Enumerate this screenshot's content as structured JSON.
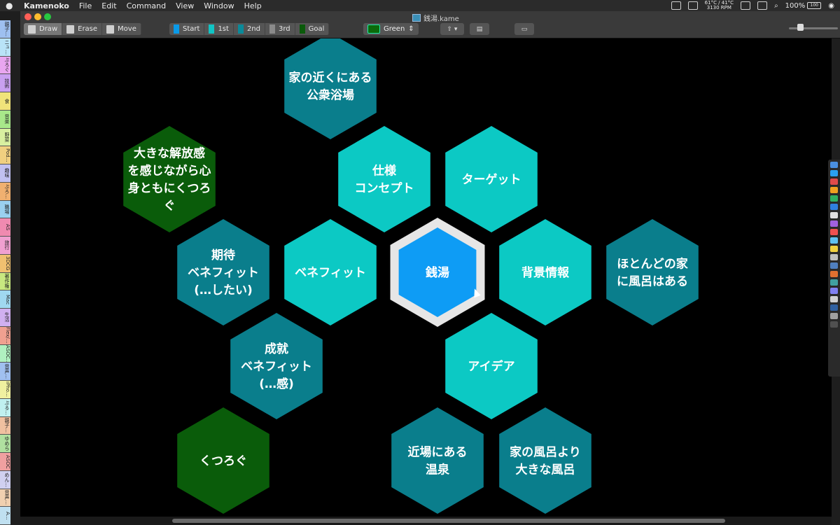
{
  "menubar": {
    "app_name": "Kamenoko",
    "items": [
      "File",
      "Edit",
      "Command",
      "View",
      "Window",
      "Help"
    ],
    "temp_line1": "61°C / 41°C",
    "temp_line2": "3130 RPM",
    "battery": "100%",
    "battery_level": "100"
  },
  "window": {
    "title": "銭湯.kame"
  },
  "toolbar": {
    "tools": [
      {
        "label": "Draw",
        "icon": "pen-icon",
        "active": true
      },
      {
        "label": "Erase",
        "icon": "trash-icon",
        "active": false
      },
      {
        "label": "Move",
        "icon": "move-icon",
        "active": false
      }
    ],
    "stages": [
      {
        "label": "Start",
        "color": "#0a9ae8"
      },
      {
        "label": "1st",
        "color": "#11c4c4"
      },
      {
        "label": "2nd",
        "color": "#0a8a9a"
      },
      {
        "label": "3rd",
        "color": "#8a8a8a"
      },
      {
        "label": "Goal",
        "color": "#0a5a0a"
      }
    ],
    "color_select": "Green"
  },
  "left_tabs": [
    {
      "label": "親子…",
      "color": "#9ec0f0"
    },
    {
      "label": "ニュ…",
      "color": "#b9e3f7"
    },
    {
      "label": "ぷろぐ",
      "color": "#e9a6f0"
    },
    {
      "label": "技術",
      "color": "#c9a0f0"
    },
    {
      "label": "食",
      "color": "#f0e37a"
    },
    {
      "label": "音楽",
      "color": "#a8e88a"
    },
    {
      "label": "野菜",
      "color": "#d8f0a0"
    },
    {
      "label": "Pod…",
      "color": "#f0d080"
    },
    {
      "label": "趣味",
      "color": "#c0c0f0"
    },
    {
      "label": "ぷろ…",
      "color": "#f0b070"
    },
    {
      "label": "職場",
      "color": "#9ad0f0"
    },
    {
      "label": "AS",
      "color": "#f08ab0"
    },
    {
      "label": "旅行",
      "color": "#f0a0d0"
    },
    {
      "label": "3DCG",
      "color": "#f0c070"
    },
    {
      "label": "著作権",
      "color": "#c8e880"
    },
    {
      "label": "Mac",
      "color": "#a0d8f0"
    },
    {
      "label": "生活",
      "color": "#d0b0f0"
    },
    {
      "label": "Flex/…",
      "color": "#f0a090"
    },
    {
      "label": "ASOC…",
      "color": "#b0f0c0"
    },
    {
      "label": "音声…",
      "color": "#a0c0f0"
    },
    {
      "label": "iPho…",
      "color": "#f0f0a0"
    },
    {
      "label": "ぷる…",
      "color": "#c0f0f0"
    },
    {
      "label": "親子…",
      "color": "#f0c0a0"
    },
    {
      "label": "ゆめら",
      "color": "#b0e0a0"
    },
    {
      "label": "ASOC",
      "color": "#f0a0a0"
    },
    {
      "label": "めん…",
      "color": "#d0d0f0"
    },
    {
      "label": "音声…",
      "color": "#f0d0b0"
    },
    {
      "label": "A…",
      "color": "#c0e0f0"
    }
  ],
  "hexagons": [
    {
      "id": "center",
      "lines": [
        "銭湯"
      ],
      "color": "#0e9cf5",
      "tier": "start",
      "selected": true
    },
    {
      "id": "shiyou",
      "lines": [
        "仕様",
        "コンセプト"
      ],
      "color": "#0cc9c4",
      "tier": "1st"
    },
    {
      "id": "target",
      "lines": [
        "ターゲット"
      ],
      "color": "#0cc9c4",
      "tier": "1st"
    },
    {
      "id": "benefit",
      "lines": [
        "ベネフィット"
      ],
      "color": "#0cc9c4",
      "tier": "1st"
    },
    {
      "id": "haikei",
      "lines": [
        "背景情報"
      ],
      "color": "#0cc9c4",
      "tier": "1st"
    },
    {
      "id": "idea",
      "lines": [
        "アイデア"
      ],
      "color": "#0cc9c4",
      "tier": "1st"
    },
    {
      "id": "ie-chikaku",
      "lines": [
        "家の近くにある",
        "公衆浴場"
      ],
      "color": "#0a7e8c",
      "tier": "2nd"
    },
    {
      "id": "kitai",
      "lines": [
        "期待",
        "ベネフィット",
        "(…したい)"
      ],
      "color": "#0a7e8c",
      "tier": "2nd"
    },
    {
      "id": "seiju",
      "lines": [
        "成就",
        "ベネフィット",
        "(…感)"
      ],
      "color": "#0a7e8c",
      "tier": "2nd"
    },
    {
      "id": "hotondo",
      "lines": [
        "ほとんどの家",
        "に風呂はある"
      ],
      "color": "#0a7e8c",
      "tier": "2nd"
    },
    {
      "id": "onsen",
      "lines": [
        "近場にある",
        "温泉"
      ],
      "color": "#0a7e8c",
      "tier": "2nd"
    },
    {
      "id": "ofuro",
      "lines": [
        "家の風呂より",
        "大きな風呂"
      ],
      "color": "#0a7e8c",
      "tier": "2nd"
    },
    {
      "id": "kaihoukan",
      "lines": [
        "大きな解放感",
        "を感じながら心",
        "身ともにくつろ",
        "ぐ"
      ],
      "color": "#0a5c0a",
      "tier": "goal"
    },
    {
      "id": "kutsurogu",
      "lines": [
        "くつろぐ"
      ],
      "color": "#0a5c0a",
      "tier": "goal"
    }
  ]
}
